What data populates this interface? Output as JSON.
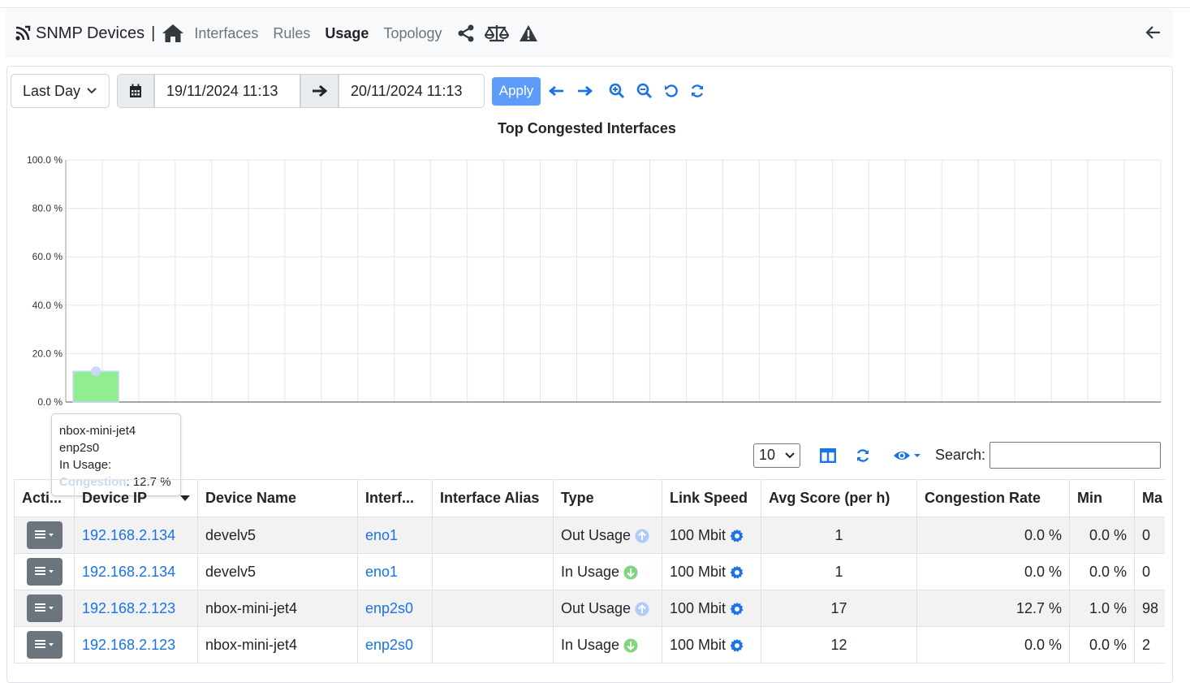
{
  "navbar": {
    "brand": "SNMP Devices",
    "separator": "|",
    "links": [
      "Interfaces",
      "Rules",
      "Usage",
      "Topology"
    ],
    "active": "Usage"
  },
  "toolbar": {
    "range_label": "Last Day",
    "date_from": "19/11/2024 11:13",
    "date_to": "20/11/2024 11:13",
    "apply_label": "Apply"
  },
  "chart_data": {
    "type": "bar",
    "title": "Top Congested Interfaces",
    "categories": [
      "nbox-mini-jet4 enp2s0"
    ],
    "series": [
      {
        "name": "Congestion",
        "values": [
          12.7
        ]
      }
    ],
    "ylim": [
      0,
      100
    ],
    "yticks": [
      "0.0 %",
      "20.0 %",
      "40.0 %",
      "60.0 %",
      "80.0 %",
      "100.0 %"
    ],
    "grid": true,
    "bar_color": "#90ee90"
  },
  "tooltip": {
    "line1": "nbox-mini-jet4",
    "line2": "enp2s0",
    "line3": "In Usage",
    "line3_suffix": ":",
    "series": "Congestion",
    "value": ": 12.7 %"
  },
  "table_tools": {
    "page_size": "10",
    "search_label": "Search:"
  },
  "table": {
    "headers": [
      "Acti...",
      "Device IP",
      "Device Name",
      "Interf...",
      "Interface Alias",
      "Type",
      "Link Speed",
      "Avg Score (per h)",
      "Congestion Rate",
      "Min",
      "Ma"
    ],
    "rows": [
      {
        "ip": "192.168.2.134",
        "name": "develv5",
        "iface": "eno1",
        "alias": "",
        "type": "Out Usage",
        "dir": "up",
        "speed": "100 Mbit",
        "avg": "1",
        "rate": "0.0 %",
        "min": "0.0 %",
        "max": "0"
      },
      {
        "ip": "192.168.2.134",
        "name": "develv5",
        "iface": "eno1",
        "alias": "",
        "type": "In Usage",
        "dir": "down",
        "speed": "100 Mbit",
        "avg": "1",
        "rate": "0.0 %",
        "min": "0.0 %",
        "max": "0"
      },
      {
        "ip": "192.168.2.123",
        "name": "nbox-mini-jet4",
        "iface": "enp2s0",
        "alias": "",
        "type": "Out Usage",
        "dir": "up",
        "speed": "100 Mbit",
        "avg": "17",
        "rate": "12.7 %",
        "min": "1.0 %",
        "max": "98"
      },
      {
        "ip": "192.168.2.123",
        "name": "nbox-mini-jet4",
        "iface": "enp2s0",
        "alias": "",
        "type": "In Usage",
        "dir": "down",
        "speed": "100 Mbit",
        "avg": "12",
        "rate": "0.0 %",
        "min": "0.0 %",
        "max": "2"
      }
    ]
  }
}
